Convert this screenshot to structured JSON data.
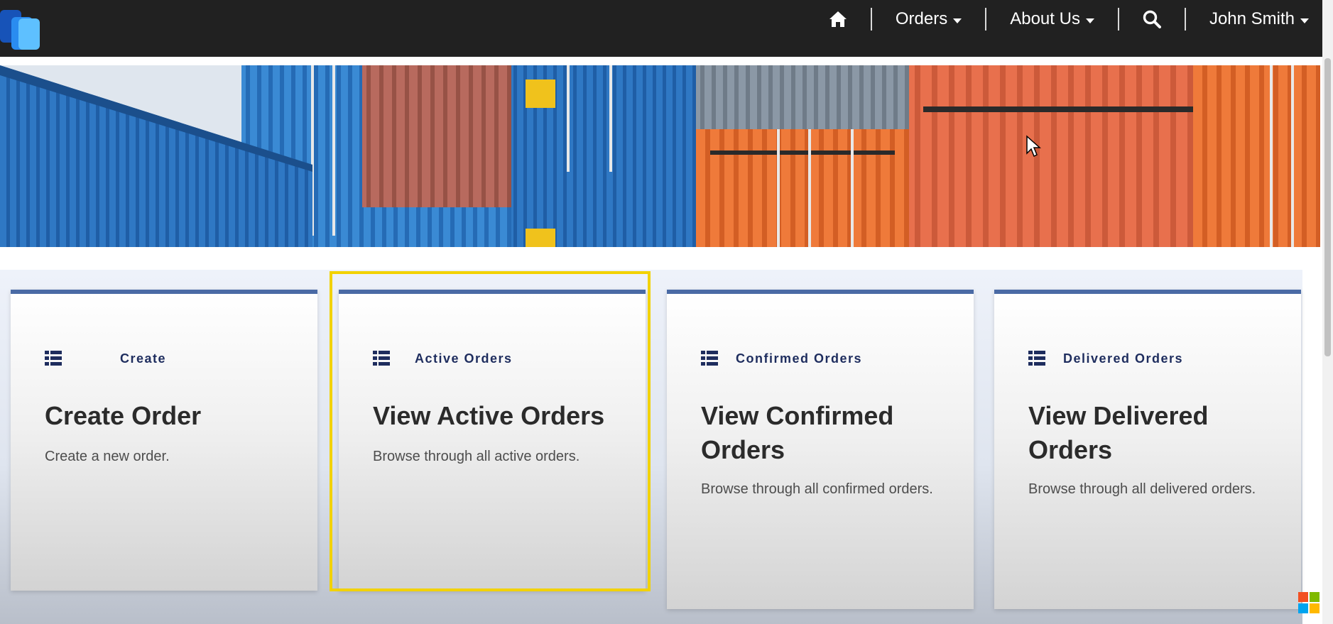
{
  "navbar": {
    "brand_icon": "app-logo-icon",
    "home_icon": "home-icon",
    "orders_label": "Orders",
    "about_label": "About Us",
    "search_icon": "search-icon",
    "user_name": "John Smith"
  },
  "banner": {
    "image": "shipping-containers-photo"
  },
  "cards": [
    {
      "category": "Create",
      "title": "Create Order",
      "description": "Create a new order."
    },
    {
      "category": "Active Orders",
      "title": "View Active Orders",
      "description": "Browse through all active orders."
    },
    {
      "category": "Confirmed Orders",
      "title": "View Confirmed Orders",
      "description": "Browse through all confirmed orders."
    },
    {
      "category": "Delivered Orders",
      "title": "View Delivered Orders",
      "description": "Browse through all delivered orders."
    }
  ],
  "colors": {
    "navbar": "#212121",
    "card_accent": "#4a6aa5",
    "category_text": "#1e2d5e",
    "highlight": "#f2d200"
  }
}
